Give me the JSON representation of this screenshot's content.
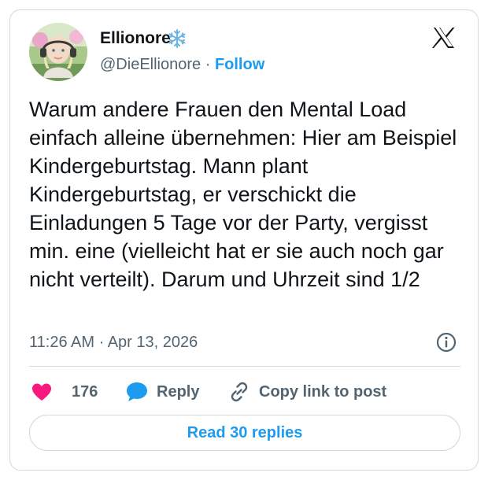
{
  "author": {
    "name": "Ellionore",
    "name_emoji": "snowflake-emoji",
    "handle": "@DieEllionore",
    "separator": "·",
    "follow_label": "Follow"
  },
  "platform_icon": "x-logo",
  "tweet": {
    "text": "Warum andere Frauen den Mental Load einfach alleine übernehmen: Hier am Beispiel Kindergeburtstag. Mann plant Kindergeburtstag, er verschickt die Einladungen 5 Tage vor der Party, vergisst min. eine (vielleicht hat er sie auch noch gar nicht verteilt). Darum und Uhrzeit sind 1/2"
  },
  "meta": {
    "time": "11:26 AM",
    "separator": "·",
    "date": "Apr 13, 2026",
    "info_icon": "info-icon"
  },
  "actions": {
    "like_count": "176",
    "reply_label": "Reply",
    "copy_label": "Copy link to post"
  },
  "read_replies_label": "Read 30 replies",
  "colors": {
    "accent": "#1d9bf0",
    "like": "#f91880",
    "text": "#0f1419",
    "secondary": "#536471",
    "border": "#cfd9de"
  }
}
